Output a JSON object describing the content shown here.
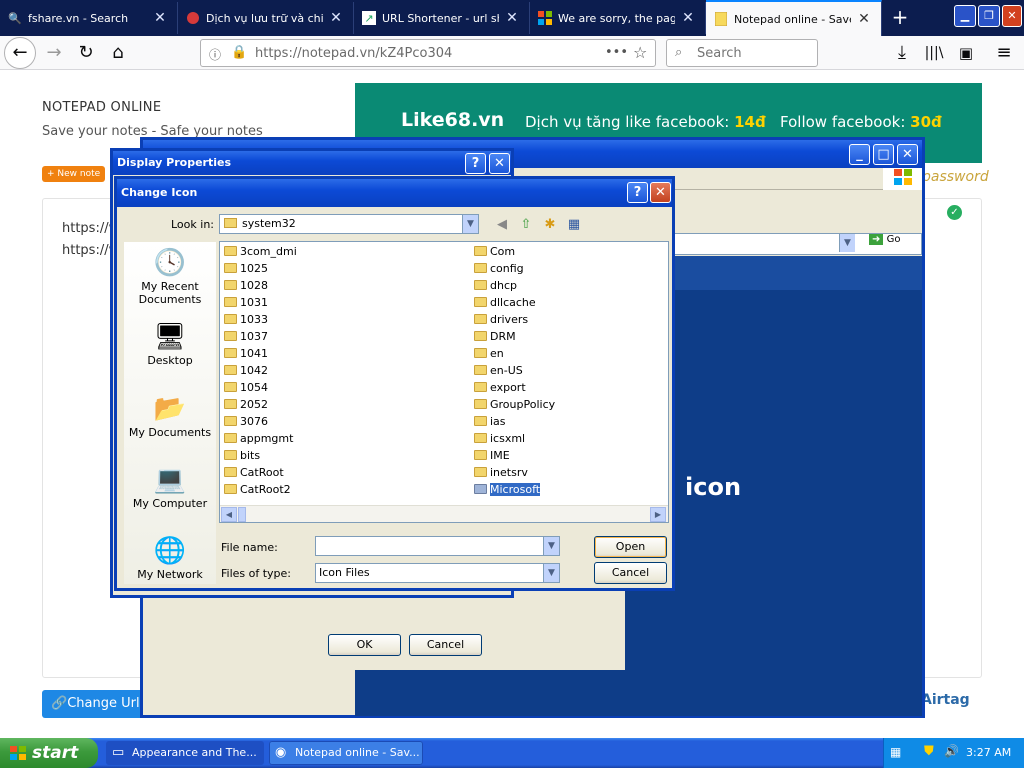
{
  "browser": {
    "tabs": [
      {
        "title": "fshare.vn - Search",
        "icon": "search-icon"
      },
      {
        "title": "Dịch vụ lưu trữ và chia s",
        "icon": "cloud-icon"
      },
      {
        "title": "URL Shortener - url short",
        "icon": "link-icon"
      },
      {
        "title": "We are sorry, the page y",
        "icon": "microsoft-icon"
      },
      {
        "title": "Notepad online - Save n",
        "icon": "notepad-icon",
        "active": true
      }
    ],
    "new_tab": "+",
    "url": "https://notepad.vn/kZ4Pco304",
    "page_actions": "•••",
    "search_placeholder": "Search"
  },
  "page": {
    "title": "NOTEPAD ONLINE",
    "subtitle": "Save your notes - Safe your notes",
    "new_note": "+ New note",
    "note_lines": [
      "https://v",
      "https://v"
    ],
    "change_url": "Change Url",
    "airtag": "Airtag",
    "password_link": "password",
    "banner": {
      "logo": "Like68.vn",
      "text_like": "Dịch vụ tăng like facebook: ",
      "price_like": "14đ",
      "text_follow": "Follow facebook: ",
      "price_follow": "30đ"
    }
  },
  "background_window": {
    "go_label": "Go",
    "big_text": "icon"
  },
  "display_properties": {
    "title": "Display Properties",
    "ok": "OK",
    "cancel": "Cancel"
  },
  "change_icon": {
    "title": "Change Icon",
    "look_in_label": "Look in:",
    "look_in_value": "system32",
    "places": [
      "My Recent Documents",
      "Desktop",
      "My Documents",
      "My Computer",
      "My Network"
    ],
    "folders_col1": [
      "3com_dmi",
      "1025",
      "1028",
      "1031",
      "1033",
      "1037",
      "1041",
      "1042",
      "1054",
      "2052",
      "3076",
      "appmgmt",
      "bits",
      "CatRoot",
      "CatRoot2"
    ],
    "folders_col2": [
      "Com",
      "config",
      "dhcp",
      "dllcache",
      "drivers",
      "DRM",
      "en",
      "en-US",
      "export",
      "GroupPolicy",
      "ias",
      "icsxml",
      "IME",
      "inetsrv",
      "Microsoft"
    ],
    "selected_folder": "Microsoft",
    "file_name_label": "File name:",
    "file_name_value": "",
    "files_of_type_label": "Files of type:",
    "files_of_type_value": "Icon Files",
    "open": "Open",
    "cancel": "Cancel"
  },
  "taskbar": {
    "start": "start",
    "tasks": [
      "Appearance and The...",
      "Notepad online - Sav..."
    ],
    "clock": "3:27 AM"
  }
}
